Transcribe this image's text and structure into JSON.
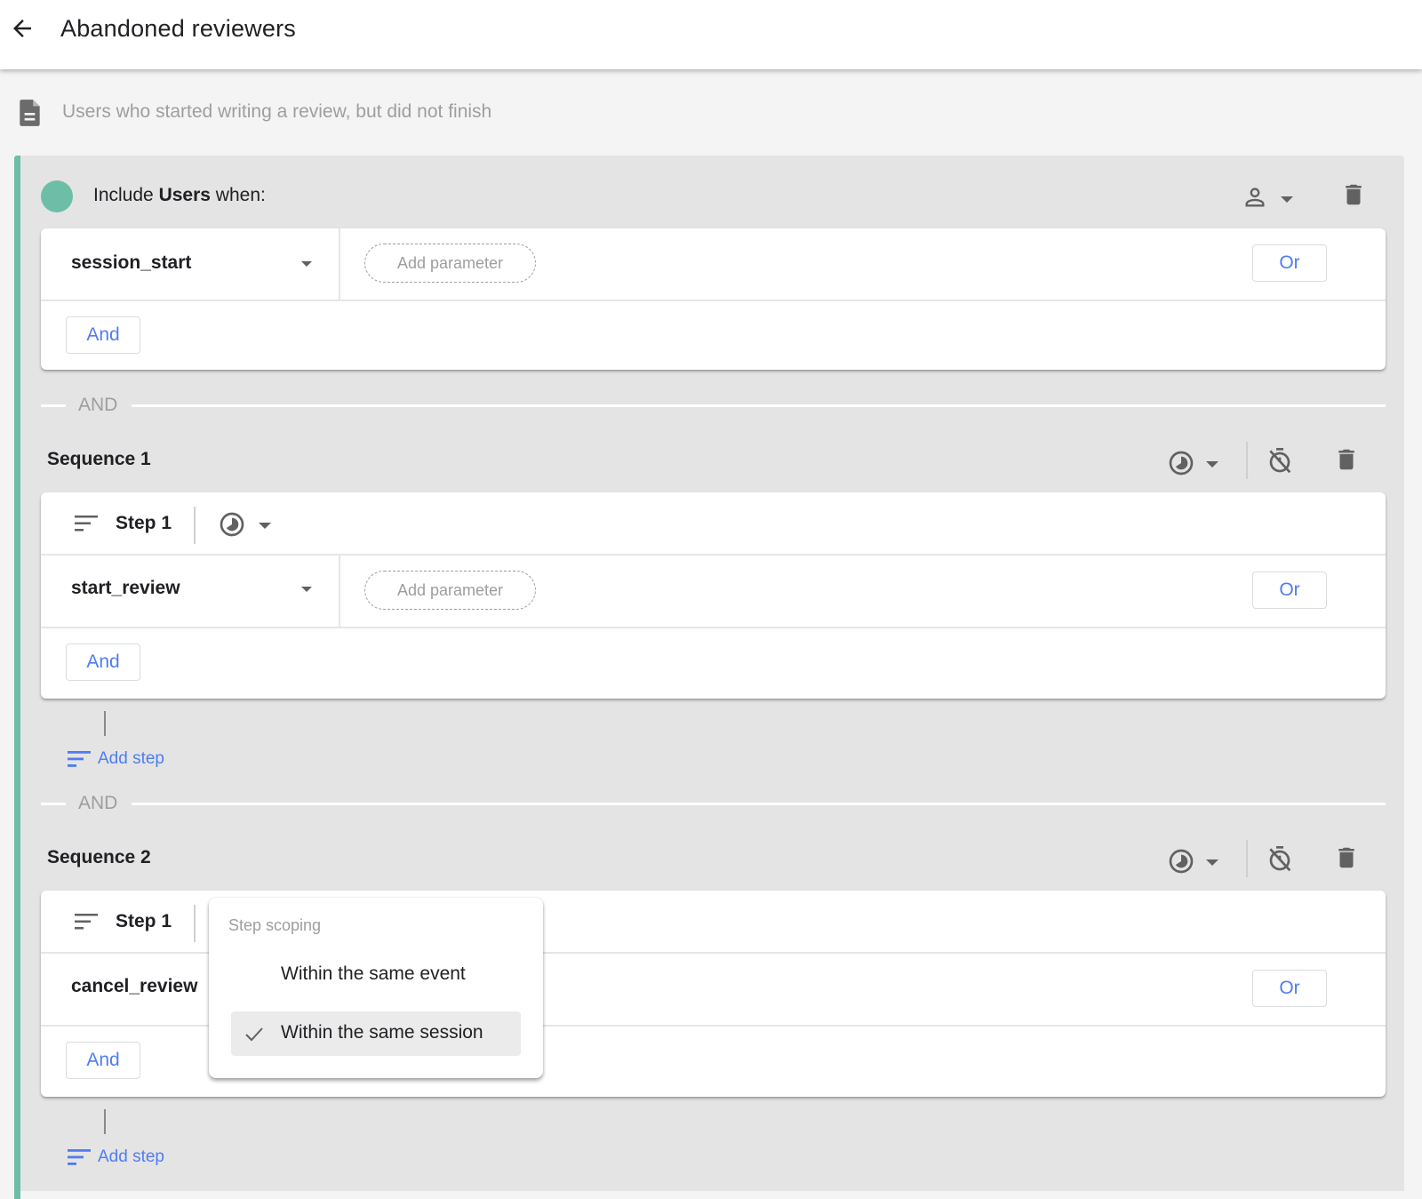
{
  "header": {
    "back_icon": "arrow-back-icon",
    "title": "Abandoned reviewers"
  },
  "description": {
    "icon": "document-icon",
    "text": "Users who started writing a review, but did not finish"
  },
  "colors": {
    "accent_green": "#6cbfa6",
    "link_blue": "#4f7df0",
    "panel_bg": "#e4e4e4",
    "muted_text": "#9e9e9e"
  },
  "include": {
    "prefix": "Include",
    "scope": "Users",
    "suffix": "when:",
    "scope_icon": "person-icon",
    "delete_icon": "trash-icon",
    "condition": {
      "event": "session_start",
      "add_parameter_label": "Add parameter",
      "or_label": "Or",
      "and_label": "And"
    }
  },
  "separators": [
    "AND",
    "AND"
  ],
  "sequences": [
    {
      "title": "Sequence 1",
      "scope_icon": "clock-scope-icon",
      "timer_icon": "timer-off-icon",
      "delete_icon": "trash-icon",
      "steps": [
        {
          "label": "Step 1",
          "event": "start_review",
          "add_parameter_label": "Add parameter",
          "or_label": "Or",
          "and_label": "And"
        }
      ],
      "add_step_label": "Add step"
    },
    {
      "title": "Sequence 2",
      "scope_icon": "clock-scope-icon",
      "timer_icon": "timer-off-icon",
      "delete_icon": "trash-icon",
      "steps": [
        {
          "label": "Step 1",
          "event": "cancel_review",
          "or_label": "Or",
          "and_label": "And"
        }
      ],
      "add_step_label": "Add step"
    }
  ],
  "step_scoping_menu": {
    "title": "Step scoping",
    "options": [
      {
        "label": "Within the same event",
        "selected": false
      },
      {
        "label": "Within the same session",
        "selected": true
      }
    ]
  }
}
